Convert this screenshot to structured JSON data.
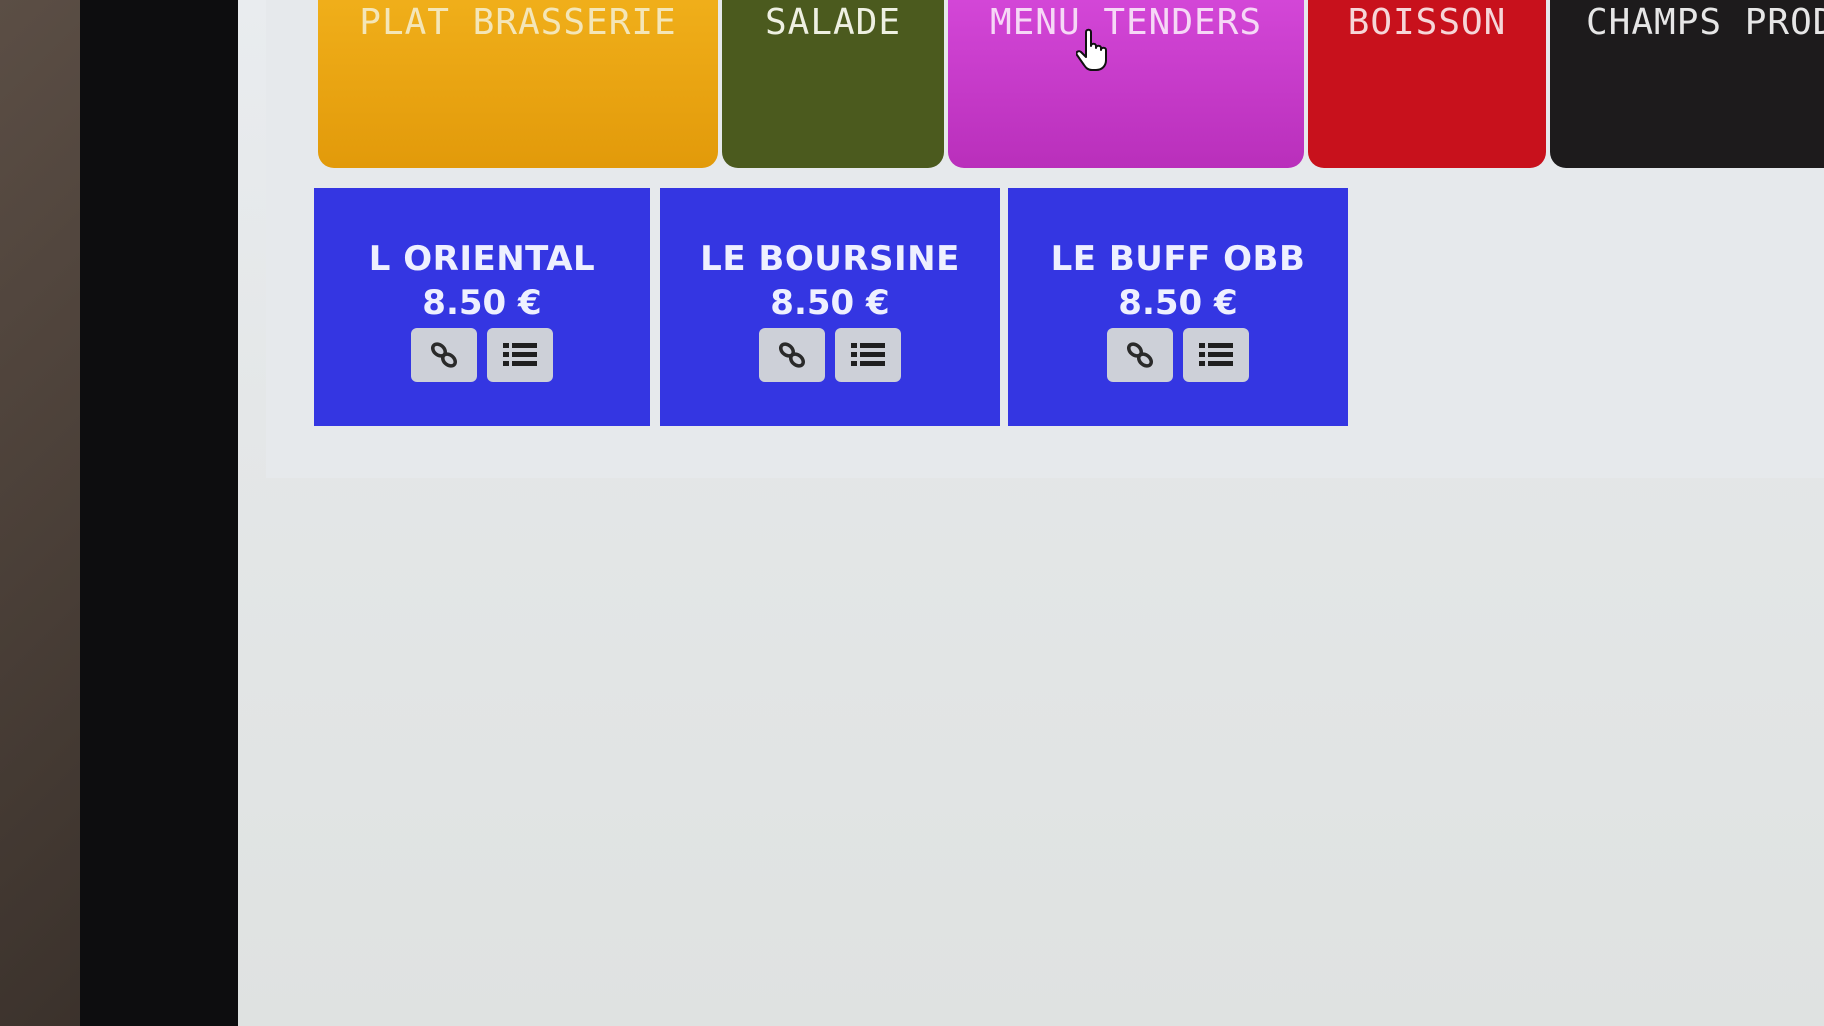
{
  "categories": [
    {
      "id": "plat",
      "label": "PLAT BRASSERIE",
      "color": "#e9a512"
    },
    {
      "id": "salade",
      "label": "SALADE",
      "color": "#4b5a1e"
    },
    {
      "id": "menu",
      "label": "MENU TENDERS",
      "color": "#c83bca"
    },
    {
      "id": "boisson",
      "label": "BOISSON",
      "color": "#c8111c"
    },
    {
      "id": "champs",
      "label": "CHAMPS PROD",
      "color": "#1d1b1c"
    }
  ],
  "products": [
    {
      "name": "L ORIENTAL",
      "price": "8.50 €"
    },
    {
      "name": "LE BOURSINE",
      "price": "8.50 €"
    },
    {
      "name": "LE BUFF OBB",
      "price": "8.50 €"
    }
  ],
  "product_color": "#3436e2",
  "icons": {
    "link": "link-icon",
    "list": "list-icon",
    "pointer": "hand-pointer-icon"
  }
}
